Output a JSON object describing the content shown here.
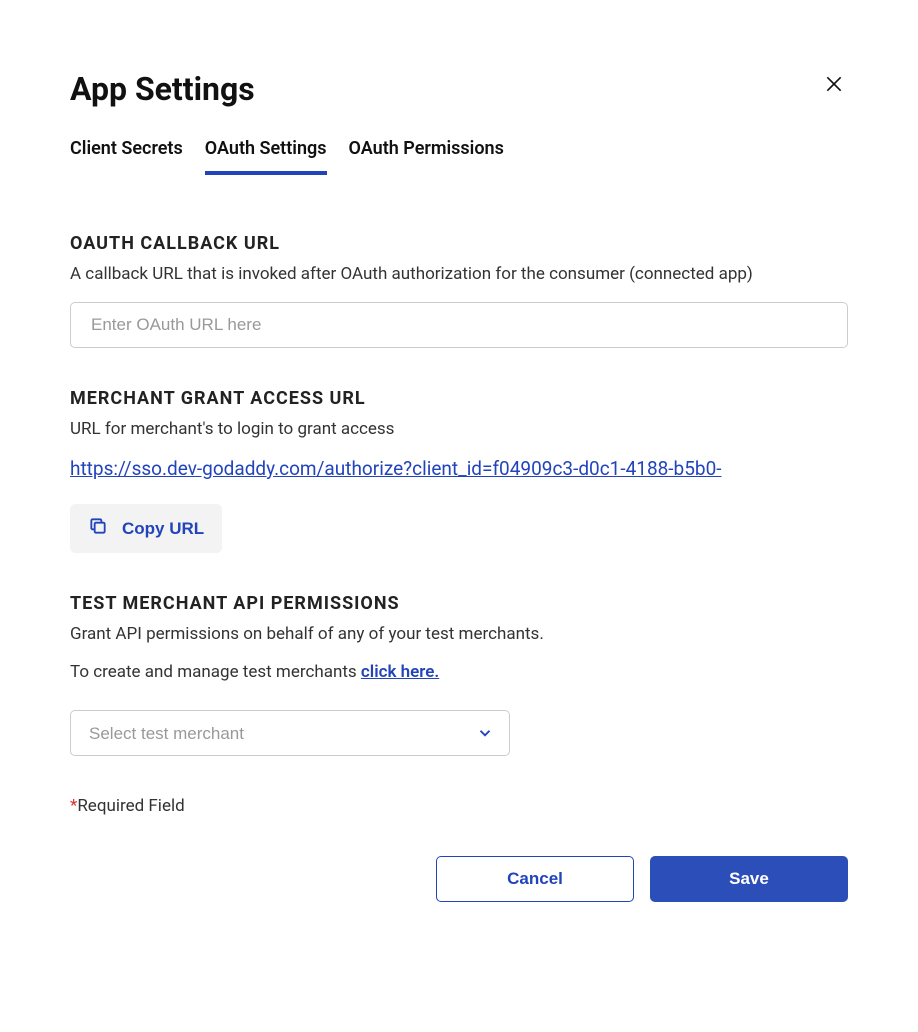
{
  "header": {
    "title": "App Settings"
  },
  "tabs": [
    {
      "label": "Client Secrets",
      "active": false
    },
    {
      "label": "OAuth Settings",
      "active": true
    },
    {
      "label": "OAuth Permissions",
      "active": false
    }
  ],
  "callback": {
    "title": "OAUTH CALLBACK URL",
    "description": "A callback URL that is invoked after OAuth authorization for the consumer (connected app)",
    "placeholder": "Enter OAuth URL here",
    "value": ""
  },
  "grant": {
    "title": "MERCHANT GRANT ACCESS URL",
    "description": "URL for merchant's to login to grant access",
    "url": "https://sso.dev-godaddy.com/authorize?client_id=f04909c3-d0c1-4188-b5b0-",
    "copy_label": "Copy URL"
  },
  "test_permissions": {
    "title": "TEST MERCHANT API PERMISSIONS",
    "description": "Grant API permissions on behalf of any of your test merchants.",
    "help_prefix": "To create and manage test merchants ",
    "help_link": "click here.",
    "select_placeholder": "Select test merchant"
  },
  "required_note": "Required Field",
  "footer": {
    "cancel": "Cancel",
    "save": "Save"
  }
}
